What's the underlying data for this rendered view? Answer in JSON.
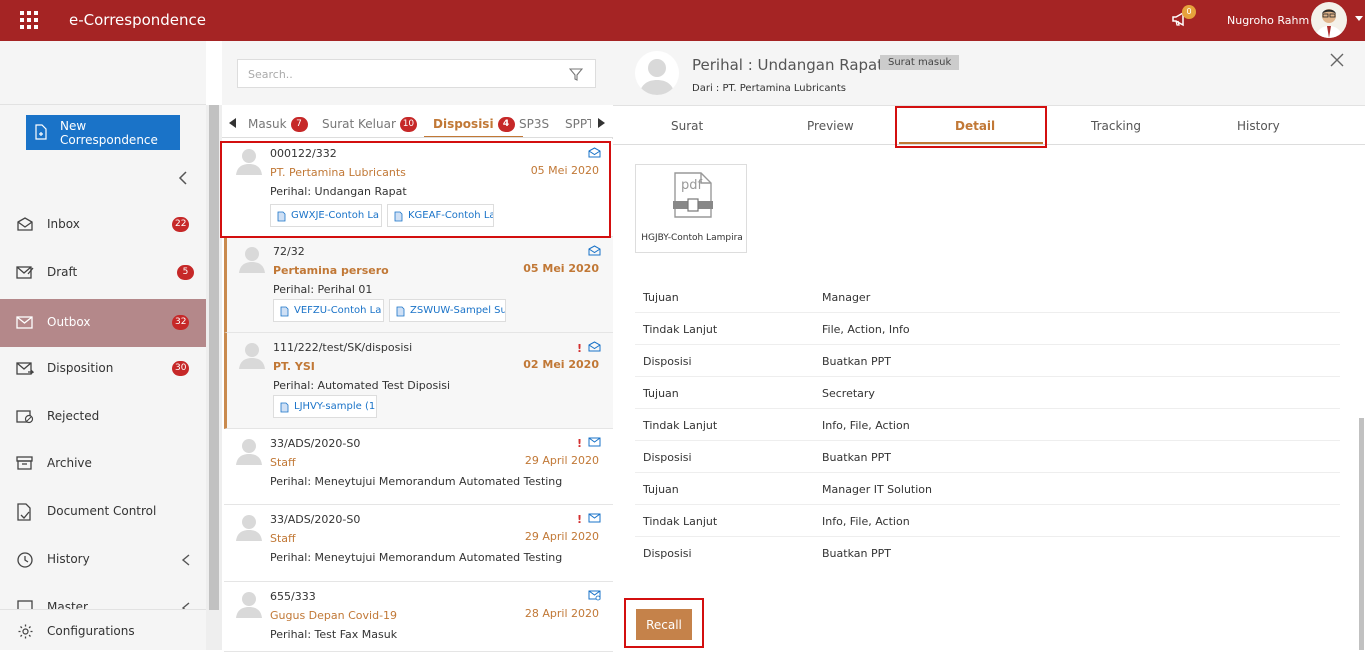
{
  "app": {
    "title": "e-Correspondence",
    "notif_count": "0",
    "user_name": "Nugroho Rahm"
  },
  "sidebar": {
    "new_button": "New Correspondence",
    "items": [
      {
        "label": "Inbox",
        "badge": "22"
      },
      {
        "label": "Draft",
        "badge": "5"
      },
      {
        "label": "Outbox",
        "badge": "32"
      },
      {
        "label": "Disposition",
        "badge": "30"
      },
      {
        "label": "Rejected",
        "badge": ""
      },
      {
        "label": "Archive",
        "badge": ""
      },
      {
        "label": "Document Control",
        "badge": ""
      },
      {
        "label": "History",
        "badge": ""
      },
      {
        "label": "Master",
        "badge": ""
      }
    ],
    "configurations": "Configurations"
  },
  "search": {
    "placeholder": "Search.."
  },
  "tabs": [
    {
      "label": "Masuk",
      "badge": "7"
    },
    {
      "label": "Surat Keluar",
      "badge": "10"
    },
    {
      "label": "Disposisi",
      "badge": "4"
    },
    {
      "label": "SP3S",
      "badge": ""
    },
    {
      "label": "SPPT",
      "badge": ""
    }
  ],
  "list": [
    {
      "number": "000122/332",
      "from": "PT. Pertamina Lubricants",
      "date": "05 Mei 2020",
      "perihal": "Perihal: Undangan Rapat",
      "attachments": [
        "GWXJE-Contoh La",
        "KGEAF-Contoh La"
      ]
    },
    {
      "number": "72/32",
      "from": "Pertamina persero",
      "date": "05 Mei 2020",
      "perihal": "Perihal: Perihal 01",
      "attachments": [
        "VEFZU-Contoh La",
        "ZSWUW-Sampel Su"
      ]
    },
    {
      "number": "111/222/test/SK/disposisi",
      "from": "PT. YSI",
      "date": "02 Mei 2020",
      "perihal": "Perihal: Automated Test Diposisi",
      "attachments": [
        "LJHVY-sample (1"
      ]
    },
    {
      "number": "33/ADS/2020-S0",
      "from": "Staff",
      "date": "29 April 2020",
      "perihal": "Perihal: Meneytujui Memorandum Automated Testing",
      "attachments": []
    },
    {
      "number": "33/ADS/2020-S0",
      "from": "Staff",
      "date": "29 April 2020",
      "perihal": "Perihal: Meneytujui Memorandum Automated Testing",
      "attachments": []
    },
    {
      "number": "655/333",
      "from": "Gugus Depan Covid-19",
      "date": "28 April 2020",
      "perihal": "Perihal: Test Fax Masuk",
      "attachments": []
    }
  ],
  "detail": {
    "subject": "Perihal : Undangan Rapat",
    "tag": "Surat masuk",
    "from": "Dari : PT. Pertamina Lubricants",
    "tabs": [
      "Surat",
      "Preview",
      "Detail",
      "Tracking",
      "History"
    ],
    "file_name": "HGJBY-Contoh Lampira",
    "file_type": "pdf",
    "rows": [
      {
        "k": "Tujuan",
        "v": "Manager"
      },
      {
        "k": "Tindak Lanjut",
        "v": "File, Action, Info"
      },
      {
        "k": "Disposisi",
        "v": "Buatkan PPT"
      },
      {
        "k": "Tujuan",
        "v": "Secretary"
      },
      {
        "k": "Tindak Lanjut",
        "v": "Info, File, Action"
      },
      {
        "k": "Disposisi",
        "v": "Buatkan PPT"
      },
      {
        "k": "Tujuan",
        "v": "Manager IT Solution"
      },
      {
        "k": "Tindak Lanjut",
        "v": "Info, File, Action"
      },
      {
        "k": "Disposisi",
        "v": "Buatkan PPT"
      }
    ],
    "recall": "Recall"
  },
  "colors": {
    "brand": "#a52424",
    "accent": "#c17836",
    "primary": "#1a73c8",
    "badge": "#c62828"
  }
}
